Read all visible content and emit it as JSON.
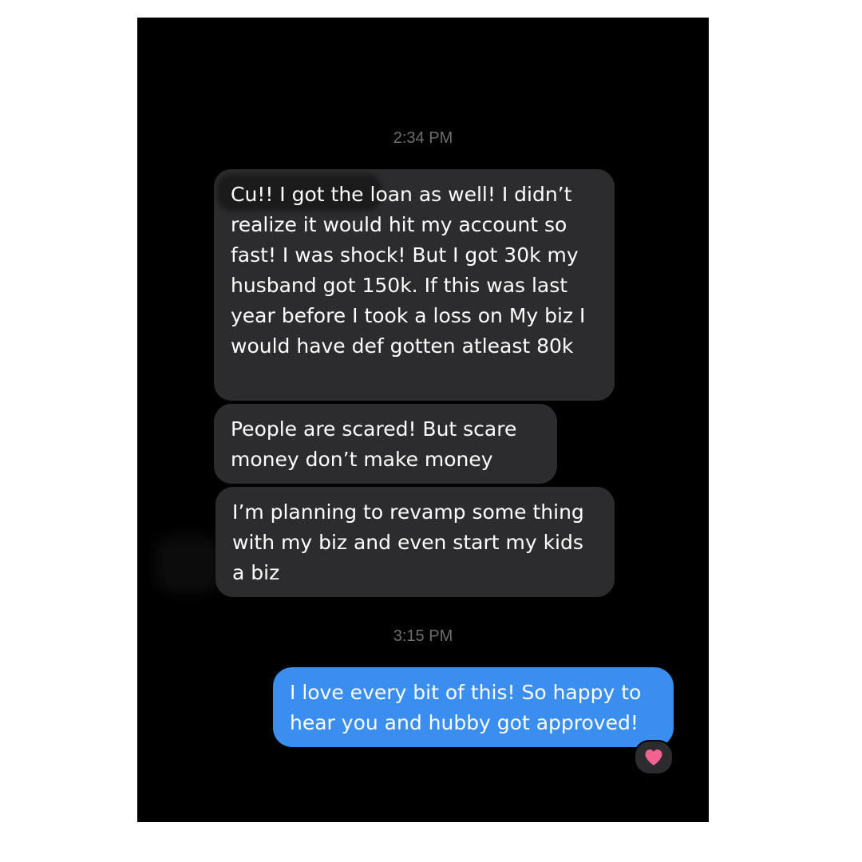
{
  "conversation": {
    "timestamps": [
      "2:34 PM",
      "3:15 PM"
    ],
    "messages": [
      {
        "direction": "received",
        "text": "Cu!! I got the loan as well! I didn’t realize it would hit my account so fast! I was shock! But I got 30k my husband got 150k. If this was last year before I took a loss on My biz I would have def gotten atleast 80k"
      },
      {
        "direction": "received",
        "text": "People are scared! But scare money don’t make money"
      },
      {
        "direction": "received",
        "text": "I’m planning to revamp some thing with my biz and even start my kids a biz"
      },
      {
        "direction": "sent",
        "text": "I love every bit of this! So happy to hear you and hubby got approved!"
      }
    ],
    "reaction": {
      "icon": "heart-icon",
      "color": "#f0628f"
    }
  },
  "colors": {
    "background": "#000000",
    "received_bubble": "#2c2c2e",
    "sent_bubble": "#3a8eef",
    "timestamp": "#6d6d72"
  }
}
